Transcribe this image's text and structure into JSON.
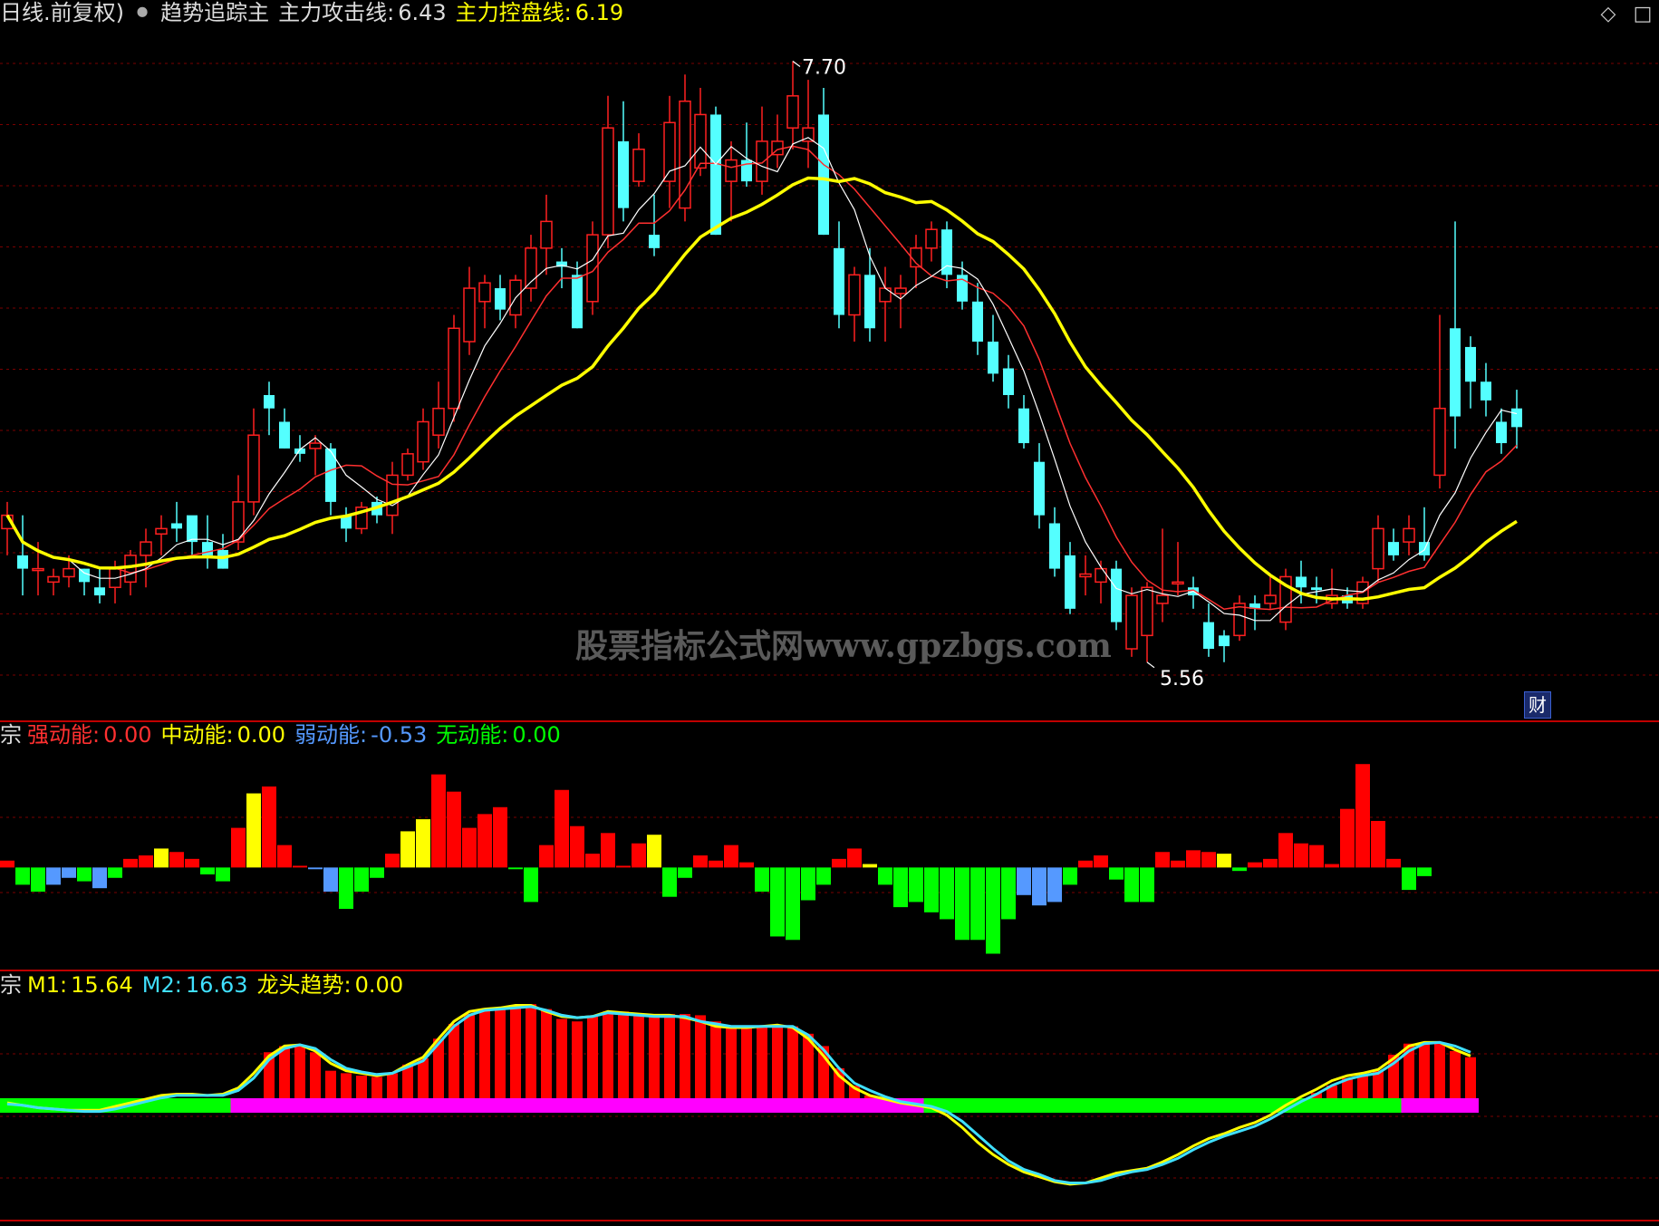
{
  "header": {
    "period": "日线.前复权)",
    "indicator_name": "趋势追踪主",
    "attack_label": "主力攻击线:",
    "attack_value": "6.43",
    "control_label": "主力控盘线:",
    "control_value": "6.19"
  },
  "price_annotations": {
    "high": "7.70",
    "low": "5.56"
  },
  "watermark": "股票指标公式网www.gpzbgs.com",
  "fin_badge": "财",
  "panel2": {
    "prefix": "宗",
    "strong_label": "强动能:",
    "strong_value": "0.00",
    "mid_label": "中动能:",
    "mid_value": "0.00",
    "weak_label": "弱动能:",
    "weak_value": "-0.53",
    "none_label": "无动能:",
    "none_value": "0.00"
  },
  "panel3": {
    "prefix": "宗",
    "m1_label": "M1:",
    "m1_value": "15.64",
    "m2_label": "M2:",
    "m2_value": "16.63",
    "trend_label": "龙头趋势:",
    "trend_value": "0.00"
  },
  "colors": {
    "up": "#ff2020",
    "down": "#54ffff",
    "ma_fast": "#ff3030",
    "ma_white": "#ffffff",
    "ma_yellow": "#ffff00",
    "strong": "#ff0000",
    "mid": "#ffff00",
    "weak": "#5599ff",
    "none": "#00ff00",
    "trend_bar": "#ff0000",
    "band_green": "#00ff00",
    "band_magenta": "#ff00ff",
    "m1": "#ffff00",
    "m2": "#40e0ff",
    "grid": "#7a0000"
  },
  "chart_data": [
    {
      "type": "candlestick",
      "ylim": [
        5.35,
        7.85
      ],
      "candles": [
        [
          6.0,
          6.1,
          5.9,
          6.05
        ],
        [
          5.9,
          6.05,
          5.75,
          5.85
        ],
        [
          5.85,
          5.95,
          5.75,
          5.85
        ],
        [
          5.8,
          5.85,
          5.75,
          5.82
        ],
        [
          5.82,
          5.9,
          5.78,
          5.85
        ],
        [
          5.85,
          5.85,
          5.75,
          5.8
        ],
        [
          5.78,
          5.85,
          5.72,
          5.75
        ],
        [
          5.78,
          5.88,
          5.72,
          5.85
        ],
        [
          5.8,
          5.92,
          5.75,
          5.9
        ],
        [
          5.9,
          6.0,
          5.78,
          5.95
        ],
        [
          5.98,
          6.05,
          5.9,
          6.0
        ],
        [
          6.02,
          6.1,
          5.95,
          6.0
        ],
        [
          6.05,
          6.0,
          5.9,
          5.95
        ],
        [
          5.95,
          6.05,
          5.85,
          5.9
        ],
        [
          5.92,
          5.98,
          5.85,
          5.85
        ],
        [
          5.95,
          6.2,
          5.92,
          6.1
        ],
        [
          6.1,
          6.45,
          6.05,
          6.35
        ],
        [
          6.5,
          6.55,
          6.35,
          6.45
        ],
        [
          6.4,
          6.45,
          6.3,
          6.3
        ],
        [
          6.3,
          6.35,
          6.25,
          6.28
        ],
        [
          6.3,
          6.35,
          6.2,
          6.32
        ],
        [
          6.3,
          6.32,
          6.05,
          6.1
        ],
        [
          6.05,
          6.08,
          5.95,
          6.0
        ],
        [
          6.0,
          6.1,
          5.98,
          6.08
        ],
        [
          6.1,
          6.12,
          6.02,
          6.05
        ],
        [
          6.05,
          6.25,
          5.98,
          6.2
        ],
        [
          6.2,
          6.3,
          6.18,
          6.28
        ],
        [
          6.25,
          6.45,
          6.22,
          6.4
        ],
        [
          6.35,
          6.55,
          6.3,
          6.45
        ],
        [
          6.45,
          6.8,
          6.4,
          6.75
        ],
        [
          6.7,
          6.98,
          6.65,
          6.9
        ],
        [
          6.85,
          6.95,
          6.75,
          6.92
        ],
        [
          6.9,
          6.95,
          6.78,
          6.82
        ],
        [
          6.8,
          6.95,
          6.75,
          6.93
        ],
        [
          6.9,
          7.1,
          6.85,
          7.05
        ],
        [
          7.05,
          7.25,
          6.95,
          7.15
        ],
        [
          7.0,
          7.05,
          6.9,
          6.98
        ],
        [
          6.95,
          7.0,
          6.75,
          6.75
        ],
        [
          6.85,
          7.15,
          6.8,
          7.1
        ],
        [
          7.1,
          7.62,
          7.05,
          7.5
        ],
        [
          7.45,
          7.6,
          7.15,
          7.2
        ],
        [
          7.3,
          7.48,
          7.28,
          7.42
        ],
        [
          7.1,
          7.25,
          7.02,
          7.05
        ],
        [
          7.3,
          7.62,
          7.2,
          7.52
        ],
        [
          7.2,
          7.7,
          7.15,
          7.6
        ],
        [
          7.35,
          7.65,
          7.32,
          7.55
        ],
        [
          7.55,
          7.58,
          7.1,
          7.1
        ],
        [
          7.3,
          7.45,
          7.15,
          7.38
        ],
        [
          7.38,
          7.52,
          7.28,
          7.3
        ],
        [
          7.3,
          7.58,
          7.25,
          7.45
        ],
        [
          7.4,
          7.55,
          7.35,
          7.45
        ],
        [
          7.5,
          7.75,
          7.42,
          7.62
        ],
        [
          7.45,
          7.68,
          7.35,
          7.5
        ],
        [
          7.55,
          7.65,
          7.1,
          7.1
        ],
        [
          7.05,
          7.15,
          6.75,
          6.8
        ],
        [
          6.8,
          6.98,
          6.7,
          6.95
        ],
        [
          6.95,
          7.05,
          6.7,
          6.75
        ],
        [
          6.85,
          6.98,
          6.7,
          6.9
        ],
        [
          6.88,
          6.95,
          6.75,
          6.9
        ],
        [
          6.98,
          7.1,
          6.9,
          7.05
        ],
        [
          7.05,
          7.15,
          7.0,
          7.12
        ],
        [
          7.12,
          7.15,
          6.9,
          6.95
        ],
        [
          6.95,
          7.0,
          6.82,
          6.85
        ],
        [
          6.85,
          6.92,
          6.65,
          6.7
        ],
        [
          6.7,
          6.8,
          6.55,
          6.58
        ],
        [
          6.6,
          6.65,
          6.45,
          6.5
        ],
        [
          6.45,
          6.5,
          6.3,
          6.32
        ],
        [
          6.25,
          6.32,
          6.0,
          6.05
        ],
        [
          6.02,
          6.08,
          5.82,
          5.85
        ],
        [
          5.9,
          5.95,
          5.68,
          5.7
        ],
        [
          5.82,
          5.9,
          5.75,
          5.83
        ],
        [
          5.8,
          5.88,
          5.72,
          5.85
        ],
        [
          5.85,
          5.88,
          5.62,
          5.65
        ],
        [
          5.55,
          5.78,
          5.52,
          5.75
        ],
        [
          5.6,
          5.8,
          5.5,
          5.78
        ],
        [
          5.72,
          6.0,
          5.65,
          5.75
        ],
        [
          5.8,
          5.95,
          5.75,
          5.8
        ],
        [
          5.78,
          5.82,
          5.7,
          5.75
        ],
        [
          5.65,
          5.72,
          5.52,
          5.55
        ],
        [
          5.6,
          5.62,
          5.5,
          5.56
        ],
        [
          5.6,
          5.75,
          5.58,
          5.72
        ],
        [
          5.72,
          5.75,
          5.62,
          5.7
        ],
        [
          5.72,
          5.82,
          5.7,
          5.75
        ],
        [
          5.65,
          5.85,
          5.62,
          5.82
        ],
        [
          5.82,
          5.88,
          5.72,
          5.78
        ],
        [
          5.78,
          5.82,
          5.72,
          5.77
        ],
        [
          5.72,
          5.85,
          5.7,
          5.75
        ],
        [
          5.75,
          5.78,
          5.7,
          5.72
        ],
        [
          5.72,
          5.82,
          5.7,
          5.8
        ],
        [
          5.85,
          6.05,
          5.8,
          6.0
        ],
        [
          5.95,
          6.0,
          5.88,
          5.9
        ],
        [
          5.95,
          6.05,
          5.9,
          6.0
        ],
        [
          5.95,
          6.08,
          5.88,
          5.9
        ],
        [
          6.2,
          6.8,
          6.15,
          6.45
        ],
        [
          6.75,
          7.15,
          6.3,
          6.42
        ],
        [
          6.68,
          6.72,
          6.45,
          6.55
        ],
        [
          6.55,
          6.62,
          6.42,
          6.48
        ],
        [
          6.4,
          6.45,
          6.28,
          6.32
        ],
        [
          6.45,
          6.52,
          6.3,
          6.38
        ]
      ],
      "ma_attack_last": 6.43,
      "ma_control_last": 6.19,
      "high_label": 7.7,
      "low_label": 5.56
    },
    {
      "type": "bar",
      "ylim": [
        -0.55,
        0.68
      ],
      "values": [
        0.04,
        -0.1,
        -0.14,
        -0.1,
        -0.06,
        -0.08,
        -0.12,
        -0.06,
        0.05,
        0.07,
        0.11,
        0.09,
        0.05,
        -0.04,
        -0.08,
        0.23,
        0.43,
        0.47,
        0.13,
        0.01,
        -0.01,
        -0.14,
        -0.24,
        -0.14,
        -0.06,
        0.08,
        0.21,
        0.28,
        0.54,
        0.44,
        0.23,
        0.31,
        0.35,
        -0.01,
        -0.2,
        0.13,
        0.45,
        0.24,
        0.08,
        0.2,
        0.01,
        0.14,
        0.19,
        -0.17,
        -0.06,
        0.07,
        0.04,
        0.13,
        0.03,
        -0.14,
        -0.4,
        -0.42,
        -0.19,
        -0.1,
        0.05,
        0.11,
        0.02,
        -0.1,
        -0.23,
        -0.2,
        -0.26,
        -0.3,
        -0.42,
        -0.42,
        -0.5,
        -0.3,
        -0.16,
        -0.22,
        -0.2,
        -0.1,
        0.04,
        0.07,
        -0.07,
        -0.2,
        -0.2,
        0.09,
        0.04,
        0.1,
        0.09,
        0.08,
        -0.02,
        0.03,
        0.05,
        0.2,
        0.14,
        0.13,
        0.02,
        0.34,
        0.6,
        0.27,
        0.05,
        -0.13,
        -0.05
      ],
      "kinds": [
        "s",
        "n",
        "n",
        "w",
        "w",
        "n",
        "w",
        "s",
        "s",
        "s",
        "m",
        "n",
        "n",
        "s",
        "s",
        "s",
        "m",
        "n",
        "n",
        "n",
        "w",
        "w",
        "s",
        "s",
        "s",
        "s",
        "m",
        "m",
        "s",
        "s",
        "s",
        "n",
        "n",
        "s",
        "m",
        "s",
        "n",
        "s",
        "s",
        "n",
        "w",
        "s",
        "m",
        "m",
        "s",
        "n",
        "n",
        "w",
        "w",
        "s",
        "s",
        "s",
        "s",
        "s",
        "s",
        "s",
        "m",
        "m",
        "m",
        "n",
        "s",
        "s",
        "s",
        "s",
        "s",
        "n",
        "w",
        "w",
        "w",
        "n",
        "n",
        "s",
        "s",
        "s",
        "s",
        "s",
        "n",
        "n",
        "s",
        "m",
        "s",
        "s",
        "n",
        "n",
        "w",
        "w",
        "n",
        "s",
        "s",
        "n",
        "n",
        "s",
        "m",
        "s",
        "n",
        "s",
        "s",
        "s",
        "s",
        "s",
        "n",
        "s"
      ]
    },
    {
      "type": "bar+line",
      "ylim": [
        4,
        22
      ],
      "bars": [
        0,
        0,
        0,
        0,
        0,
        0,
        0,
        0,
        0,
        0,
        0,
        0,
        0,
        0,
        0,
        0,
        0,
        17.5,
        18.0,
        18.0,
        17.5,
        16.0,
        15.8,
        15.6,
        15.5,
        15.8,
        16.5,
        17.0,
        18.6,
        19.8,
        20.6,
        20.9,
        21.0,
        21.2,
        21.4,
        21.0,
        20.2,
        20.0,
        20.4,
        20.8,
        20.8,
        20.6,
        20.6,
        20.6,
        20.6,
        20.5,
        20.0,
        19.6,
        19.6,
        19.6,
        19.6,
        19.6,
        19.0,
        18.0,
        16.2,
        14.8,
        14.0,
        13.5,
        13.2,
        13.0,
        12.8,
        12.5,
        11.6,
        10.4,
        9.4,
        8.6,
        8.0,
        7.5,
        7.2,
        7.0,
        7.0,
        7.2,
        7.6,
        8.0,
        8.0,
        8.4,
        9.0,
        9.6,
        10.2,
        10.7,
        11.2,
        11.5,
        12.0,
        12.8,
        13.5,
        14.2,
        14.8,
        15.4,
        15.6,
        16.0,
        17.3,
        18.2,
        18.3,
        18.2,
        17.6,
        17.1
      ],
      "bar_active_from": [
        17,
        53
      ],
      "bar_active_from2": [
        91,
        96
      ],
      "m1": [
        13.4,
        13.2,
        13.0,
        12.9,
        12.8,
        12.8,
        12.8,
        13.1,
        13.4,
        13.7,
        14.0,
        14.1,
        14.1,
        14.0,
        14.1,
        14.6,
        15.8,
        17.2,
        18.0,
        18.1,
        17.6,
        16.6,
        16.0,
        15.8,
        15.6,
        15.8,
        16.5,
        17.1,
        18.6,
        20.0,
        20.8,
        21.0,
        21.1,
        21.3,
        21.3,
        20.8,
        20.4,
        20.3,
        20.4,
        20.8,
        20.7,
        20.6,
        20.5,
        20.5,
        20.3,
        20.0,
        19.6,
        19.5,
        19.5,
        19.6,
        19.7,
        19.5,
        18.6,
        17.2,
        15.6,
        14.6,
        14.0,
        13.7,
        13.4,
        13.2,
        13.0,
        12.4,
        11.4,
        10.2,
        9.2,
        8.4,
        7.8,
        7.4,
        7.0,
        6.8,
        6.9,
        7.3,
        7.7,
        7.9,
        8.1,
        8.6,
        9.2,
        9.9,
        10.5,
        10.9,
        11.4,
        11.8,
        12.4,
        13.2,
        13.9,
        14.5,
        15.2,
        15.6,
        15.8,
        16.1,
        17.0,
        18.0,
        18.3,
        18.3,
        17.7,
        17.2
      ],
      "m2": [
        13.3,
        13.2,
        13.0,
        12.9,
        12.8,
        12.7,
        12.7,
        12.9,
        13.2,
        13.5,
        13.8,
        14.0,
        14.0,
        14.0,
        14.0,
        14.4,
        15.4,
        16.9,
        17.8,
        18.1,
        17.8,
        16.9,
        16.2,
        15.9,
        15.7,
        15.8,
        16.3,
        16.8,
        18.2,
        19.6,
        20.5,
        20.9,
        21.0,
        21.1,
        21.2,
        20.9,
        20.5,
        20.3,
        20.4,
        20.7,
        20.6,
        20.5,
        20.4,
        20.4,
        20.4,
        20.0,
        19.8,
        19.6,
        19.6,
        19.6,
        19.6,
        19.6,
        18.9,
        17.7,
        16.2,
        15.0,
        14.4,
        13.9,
        13.5,
        13.3,
        13.1,
        12.7,
        11.9,
        10.8,
        9.7,
        8.7,
        8.0,
        7.6,
        7.1,
        6.9,
        6.9,
        7.1,
        7.5,
        7.8,
        8.0,
        8.4,
        8.9,
        9.6,
        10.2,
        10.7,
        11.1,
        11.5,
        12.1,
        12.8,
        13.5,
        14.1,
        14.8,
        15.3,
        15.6,
        15.8,
        16.6,
        17.6,
        18.2,
        18.3,
        18.0,
        17.5
      ],
      "band": [
        "g",
        "g",
        "g",
        "g",
        "g",
        "g",
        "g",
        "g",
        "g",
        "g",
        "g",
        "g",
        "g",
        "g",
        "g",
        "m",
        "m",
        "m",
        "m",
        "m",
        "m",
        "m",
        "m",
        "m",
        "m",
        "m",
        "m",
        "m",
        "m",
        "m",
        "m",
        "m",
        "m",
        "m",
        "m",
        "m",
        "m",
        "m",
        "m",
        "m",
        "m",
        "m",
        "m",
        "m",
        "m",
        "m",
        "m",
        "m",
        "m",
        "m",
        "m",
        "m",
        "m",
        "m",
        "m",
        "m",
        "m",
        "m",
        "m",
        "m",
        "g",
        "g",
        "g",
        "g",
        "g",
        "g",
        "g",
        "g",
        "g",
        "g",
        "g",
        "g",
        "g",
        "g",
        "g",
        "g",
        "g",
        "g",
        "g",
        "g",
        "g",
        "g",
        "g",
        "g",
        "g",
        "g",
        "g",
        "g",
        "g",
        "g",
        "g",
        "m",
        "m",
        "m",
        "m",
        "m"
      ]
    }
  ]
}
